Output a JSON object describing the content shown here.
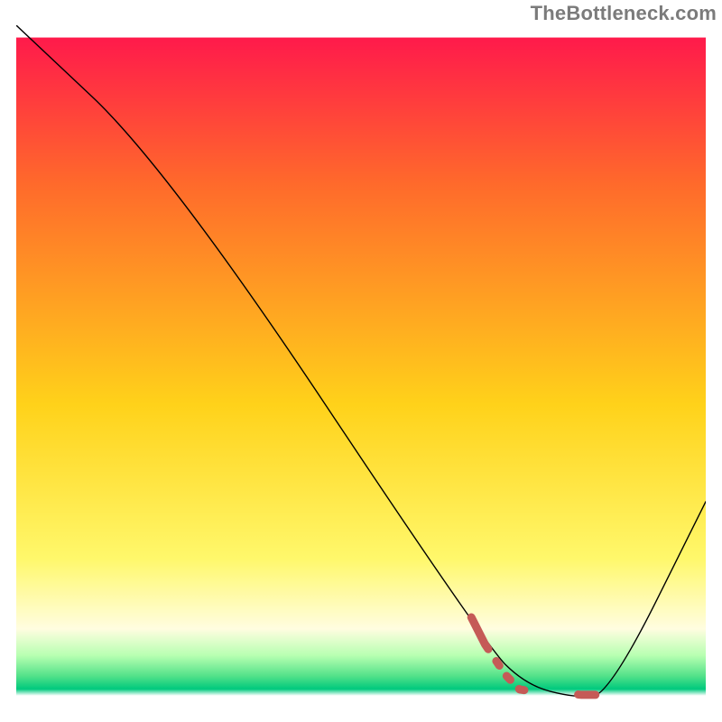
{
  "watermark": "TheBottleneck.com",
  "colors": {
    "gradient_top": "#ff1a4b",
    "gradient_upper": "#ff6a2b",
    "gradient_mid": "#ffd21a",
    "gradient_lower": "#fff86b",
    "gradient_cream": "#fffde0",
    "gradient_green1": "#b7ffb1",
    "gradient_green2": "#55e28a",
    "gradient_green3": "#00c97d",
    "white": "#ffffff",
    "black": "#000000",
    "curve": "#000000",
    "dashed": "#c55a57"
  },
  "chart_data": {
    "type": "line",
    "title": "",
    "xlabel": "",
    "ylabel": "",
    "x_range": [
      0,
      100
    ],
    "y_range": [
      0,
      100
    ],
    "series": [
      {
        "name": "bottleneck-curve",
        "style": "solid",
        "color_key": "curve",
        "stroke_width": 1.4,
        "points": [
          {
            "x": 0,
            "y": 100
          },
          {
            "x": 22,
            "y": 79
          },
          {
            "x": 68,
            "y": 9
          },
          {
            "x": 74,
            "y": 3
          },
          {
            "x": 81,
            "y": 1.2
          },
          {
            "x": 86,
            "y": 1.5
          },
          {
            "x": 100,
            "y": 30
          }
        ]
      },
      {
        "name": "highlight-segment",
        "style": "dashed",
        "color_key": "dashed",
        "stroke_width": 9,
        "points": [
          {
            "x": 66,
            "y": 13
          },
          {
            "x": 68,
            "y": 9
          },
          {
            "x": 71,
            "y": 4.5
          },
          {
            "x": 73,
            "y": 2.4
          },
          {
            "x": 75,
            "y": 2.1
          },
          {
            "x": 78,
            "y": 2.0
          },
          {
            "x": 80,
            "y": 1.8
          },
          {
            "x": 82,
            "y": 1.6
          },
          {
            "x": 84,
            "y": 1.6
          }
        ]
      }
    ],
    "gradient_stops": [
      {
        "offset": 0.0,
        "color_key": "gradient_top"
      },
      {
        "offset": 0.22,
        "color_key": "gradient_upper"
      },
      {
        "offset": 0.55,
        "color_key": "gradient_mid"
      },
      {
        "offset": 0.78,
        "color_key": "gradient_lower"
      },
      {
        "offset": 0.885,
        "color_key": "gradient_cream"
      },
      {
        "offset": 0.925,
        "color_key": "gradient_green1"
      },
      {
        "offset": 0.955,
        "color_key": "gradient_green2"
      },
      {
        "offset": 0.975,
        "color_key": "gradient_green3"
      },
      {
        "offset": 0.985,
        "color_key": "white"
      }
    ],
    "gradient_rect": {
      "x": 0,
      "y": 0,
      "w": 100,
      "h": 98.2
    }
  }
}
